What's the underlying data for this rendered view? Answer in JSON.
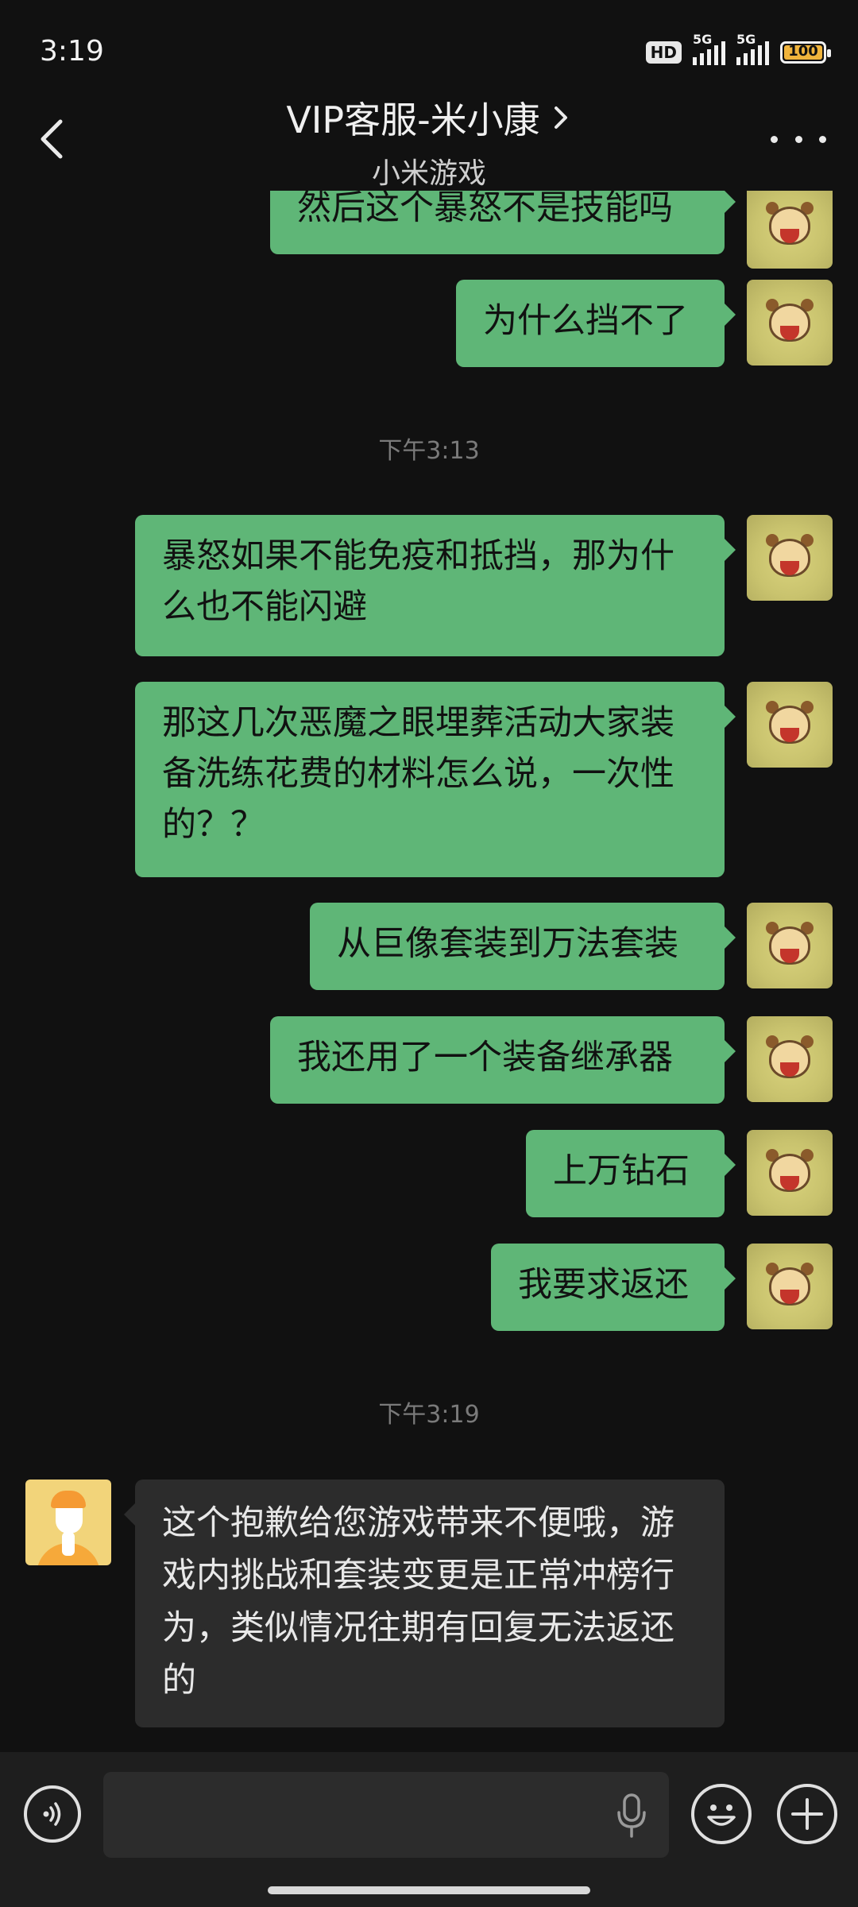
{
  "status_bar": {
    "time": "3:19",
    "hd_label": "HD",
    "network_1": "5G",
    "network_2": "5G",
    "battery": "100",
    "battery_color": "#f0b43c"
  },
  "header": {
    "title": "VIP客服-米小康",
    "subtitle": "小米游戏"
  },
  "timestamps": [
    "下午3:13",
    "下午3:19"
  ],
  "messages_out": [
    {
      "text": "然后这个暴怒不是技能吗"
    },
    {
      "text": "为什么挡不了"
    },
    {
      "text": "暴怒如果不能免疫和抵挡，那为什么也不能闪避"
    },
    {
      "text": "那这几次恶魔之眼埋葬活动大家装备洗练花费的材料怎么说，一次性的？？"
    },
    {
      "text": "从巨像套装到万法套装"
    },
    {
      "text": "我还用了一个装备继承器"
    },
    {
      "text": "上万钻石"
    },
    {
      "text": "我要求返还"
    }
  ],
  "messages_in": [
    {
      "text": "这个抱歉给您游戏带来不便哦，游戏内挑战和套装变更是正常冲榜行为，类似情况往期有回复无法返还的"
    }
  ],
  "input": {
    "value": "",
    "placeholder": ""
  },
  "colors": {
    "outgoing_bubble": "#5fb677",
    "incoming_bubble": "#2c2c2c",
    "background": "#111111"
  },
  "icons": [
    "back-chevron-icon",
    "chevron-right-icon",
    "more-icon",
    "voice-icon",
    "mic-icon",
    "emoji-icon",
    "plus-icon"
  ]
}
